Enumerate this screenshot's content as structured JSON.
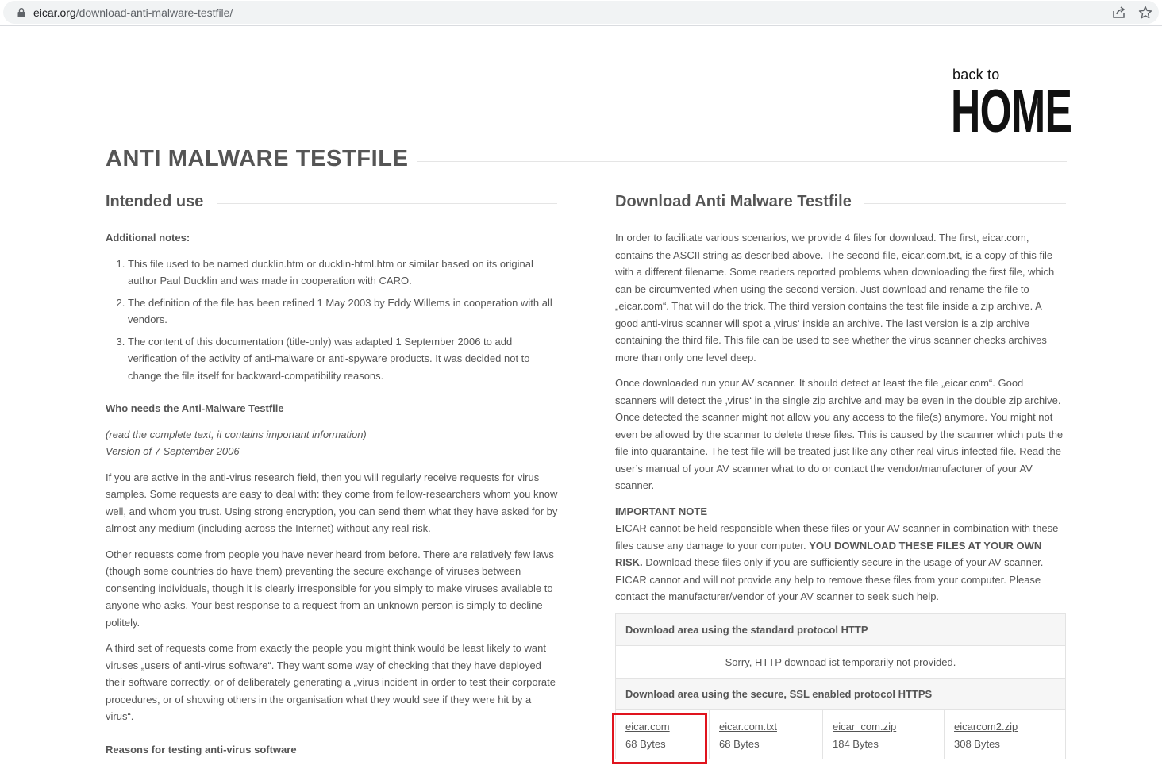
{
  "browser": {
    "url_host": "eicar.org",
    "url_path": "/download-anti-malware-testfile/"
  },
  "logo": {
    "top": "back to",
    "main": "HOME"
  },
  "page_title": "ANTI MALWARE TESTFILE",
  "left": {
    "heading": "Intended use",
    "additional_notes_label": "Additional notes:",
    "notes": [
      "This file used to be named ducklin.htm or ducklin-html.htm or similar based on its original author Paul Ducklin and was made in cooperation with CARO.",
      "The definition of the file has been refined 1 May 2003 by Eddy Willems in cooperation with all vendors.",
      "The content of this documentation (title-only) was adapted 1 September 2006 to add verification of the activity of anti-malware or anti-spyware products. It was decided not to change the file itself for backward-compatibility reasons."
    ],
    "who_needs_heading": "Who needs the Anti-Malware Testfile",
    "read_note": "(read the complete text, it contains important information)",
    "version": "Version of 7 September 2006",
    "paragraphs": [
      "If you are active in the anti-virus research field, then you will regularly receive requests for virus samples. Some requests are easy to deal with: they come from fellow-researchers whom you know well, and whom you trust. Using strong encryption, you can send them what they have asked for by almost any medium (including across the Internet) without any real risk.",
      "Other requests come from people you have never heard from before. There are relatively few laws (though some countries do have them) preventing the secure exchange of viruses between consenting individuals, though it is clearly irresponsible for you simply to make viruses available to anyone who asks. Your best response to a request from an unknown person is simply to decline politely.",
      "A third set of requests come from exactly the people you might think would be least likely to want viruses „users of anti-virus software“. They want some way of checking that they have deployed their software correctly, or of deliberately generating a „virus incident in order to test their corporate procedures, or of showing others in the organisation what they would see if they were hit by a virus“."
    ],
    "reasons_heading": "Reasons for testing anti-virus software"
  },
  "right": {
    "heading": "Download Anti Malware Testfile",
    "p1": "In order to facilitate various scenarios, we provide 4 files for download. The first, eicar.com, contains the ASCII string as described above. The second file, eicar.com.txt, is a copy of this file with a different filename. Some readers reported problems when downloading the first file, which can be circumvented when using the second version. Just download and rename the file to „eicar.com“. That will do the trick. The third version contains the test file inside a zip archive. A good anti-virus scanner will spot a ‚virus‘ inside an archive. The last version is a zip archive containing the third file. This file can be used to see whether the virus scanner checks archives more than only one level deep.",
    "p2": "Once downloaded run your AV scanner. It should detect at least the file „eicar.com“. Good scanners will detect the ‚virus‘ in the single zip archive and may be even in the double zip archive. Once detected the scanner might not allow you any access to the file(s) anymore. You might not even be allowed by the scanner to delete these files. This is caused by the scanner which puts the file into quarantaine. The test file will be treated just like any other real virus infected file. Read the user’s manual of your AV scanner what to do or contact the vendor/manufacturer of your AV scanner.",
    "important_label": "IMPORTANT NOTE",
    "important_a": "EICAR cannot be held responsible when these files or your AV scanner in combination with these files cause any damage to your computer. ",
    "important_bold": "YOU DOWNLOAD THESE FILES AT YOUR OWN RISK.",
    "important_b": "  Download these files only if you are sufficiently secure in the usage of your AV scanner. EICAR cannot and will not provide any help to remove these files from your computer. Please contact the manufacturer/vendor of your AV scanner to seek such help.",
    "table": {
      "http_header": "Download area using the standard protocol HTTP",
      "http_note": "– Sorry, HTTP downoad ist temporarily not provided. –",
      "https_header": "Download area using the secure, SSL enabled protocol HTTPS",
      "files": [
        {
          "name": "eicar.com",
          "size": "68 Bytes"
        },
        {
          "name": "eicar.com.txt",
          "size": "68 Bytes"
        },
        {
          "name": "eicar_com.zip",
          "size": "184 Bytes"
        },
        {
          "name": "eicarcom2.zip",
          "size": "308 Bytes"
        }
      ]
    }
  },
  "colors": {
    "text": "#555555",
    "highlight": "#e0141e",
    "table_header_bg": "#f6f6f6"
  }
}
